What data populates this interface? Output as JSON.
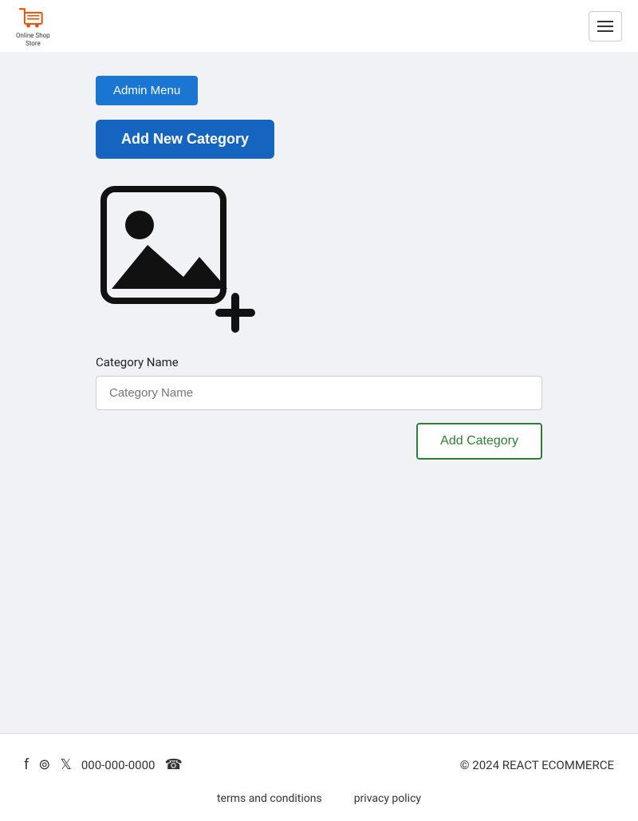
{
  "header": {
    "logo_text_line1": "Online Shop",
    "logo_text_line2": "Store"
  },
  "main": {
    "admin_menu_label": "Admin Menu",
    "add_new_category_label": "Add New Category",
    "form": {
      "label": "Category Name",
      "placeholder": "Category Name",
      "submit_label": "Add Category"
    }
  },
  "footer": {
    "phone": "000-000-0000",
    "copyright": "© 2024 REACT ECOMMERCE",
    "links": [
      {
        "label": "terms and conditions"
      },
      {
        "label": "privacy policy"
      }
    ]
  }
}
